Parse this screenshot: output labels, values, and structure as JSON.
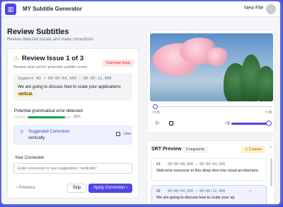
{
  "header": {
    "logo_glyph": "▥",
    "title": "MY Subtitle Generator",
    "new_file_label": "New File"
  },
  "page": {
    "title": "Review Subtitles",
    "subtitle": "Review detected issues and make corrections"
  },
  "issue": {
    "warning_glyph": "⚠",
    "title": "Review Issue 1 of 3",
    "badge": "Grammar Issue",
    "description": "Review and correct potential subtitle errors",
    "segment_header": "Segment #2 • 00:00:04,500 – 00:00:12,000",
    "segment_text_before": "We are going to discuss how to scale your applications ",
    "segment_text_error": "vertical",
    "segment_text_after": ".",
    "error_label": "Potential grammatical error detected",
    "confidence_fraction": 0.85,
    "confidence_label": "85%",
    "suggestion_glyph": "◎",
    "suggestion_title": "Suggested Correction",
    "suggestion_text": "vertically",
    "use_label": "Use",
    "correction_label": "Your Correction",
    "correction_placeholder": "Enter correction or use suggestion: \"vertically\"",
    "previous_label": "‹  Previous",
    "skip_label": "Skip",
    "apply_label": "Apply Correction  ›"
  },
  "player": {
    "progress_fraction": 0.0,
    "current_time": "0:05",
    "total_time": "7:36",
    "play_glyph": "▷",
    "volume_glyph": "◁)",
    "volume_fraction": 1.0
  },
  "srt": {
    "title": "SRT Preview",
    "segments_badge": "5 segments",
    "issues_badge": "⚠ 3 issues",
    "collapse_glyph": "⌃",
    "entries": [
      {
        "num": "#1",
        "time": "00:00:00,000 → 00:00:04,500",
        "text": "Welcome everyone to this deep dive into cloud architecture.",
        "flagged": false
      },
      {
        "num": "#2",
        "time": "00:00:04,500 → 00:00:12,000",
        "text": "We are going to discuss how to scale your ap",
        "flagged": true
      }
    ]
  },
  "colors": {
    "accent": "#4f46e5",
    "warning": "#f59e0b",
    "error": "#dc2626",
    "success": "#16a34a"
  }
}
